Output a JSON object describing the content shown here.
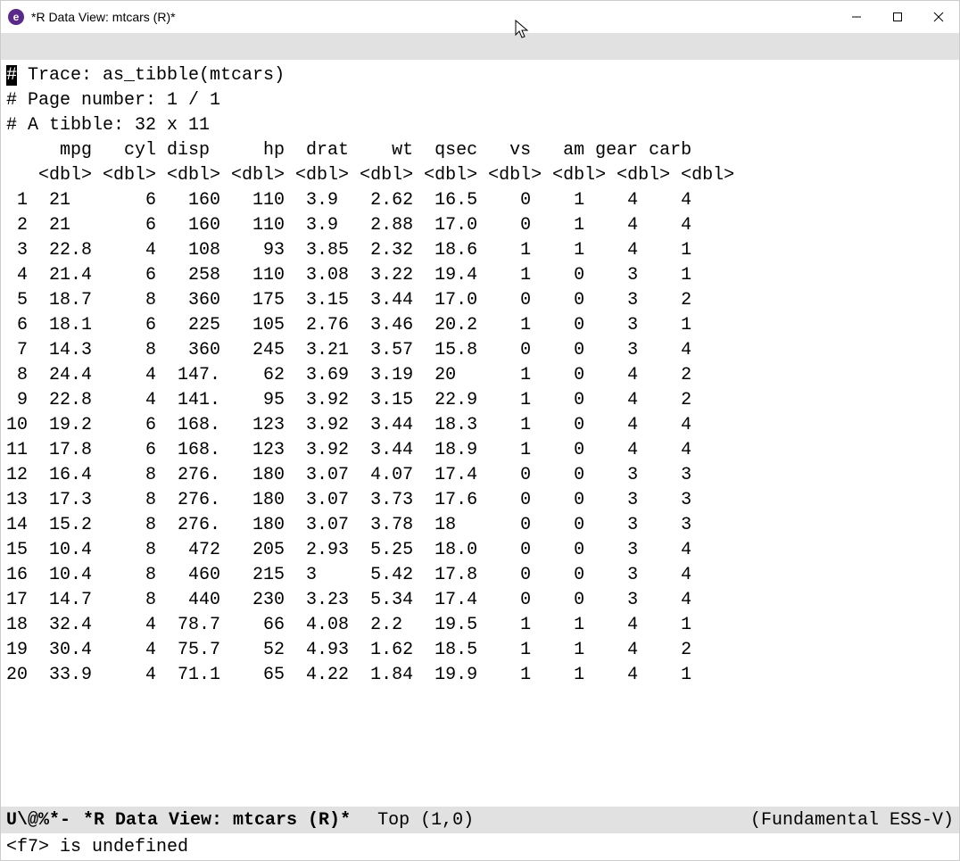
{
  "window": {
    "title": "*R Data View: mtcars (R)*"
  },
  "header": {
    "trace_prefix": "#",
    "trace_label": " Trace: as_tibble(mtcars)",
    "page_line": "# Page number: 1 / 1",
    "tibble_line": "# A tibble: 32 x 11"
  },
  "columns": [
    "mpg",
    "cyl",
    "disp",
    "hp",
    "drat",
    "wt",
    "qsec",
    "vs",
    "am",
    "gear",
    "carb"
  ],
  "types": [
    "<dbl>",
    "<dbl>",
    "<dbl>",
    "<dbl>",
    "<dbl>",
    "<dbl>",
    "<dbl>",
    "<dbl>",
    "<dbl>",
    "<dbl>",
    "<dbl>"
  ],
  "rows": [
    {
      "n": "1",
      "mpg": "21",
      "cyl": "6",
      "disp": "160",
      "hp": "110",
      "drat": "3.9",
      "wt": "2.62",
      "qsec": "16.5",
      "vs": "0",
      "am": "1",
      "gear": "4",
      "carb": "4"
    },
    {
      "n": "2",
      "mpg": "21",
      "cyl": "6",
      "disp": "160",
      "hp": "110",
      "drat": "3.9",
      "wt": "2.88",
      "qsec": "17.0",
      "vs": "0",
      "am": "1",
      "gear": "4",
      "carb": "4"
    },
    {
      "n": "3",
      "mpg": "22.8",
      "cyl": "4",
      "disp": "108",
      "hp": "93",
      "drat": "3.85",
      "wt": "2.32",
      "qsec": "18.6",
      "vs": "1",
      "am": "1",
      "gear": "4",
      "carb": "1"
    },
    {
      "n": "4",
      "mpg": "21.4",
      "cyl": "6",
      "disp": "258",
      "hp": "110",
      "drat": "3.08",
      "wt": "3.22",
      "qsec": "19.4",
      "vs": "1",
      "am": "0",
      "gear": "3",
      "carb": "1"
    },
    {
      "n": "5",
      "mpg": "18.7",
      "cyl": "8",
      "disp": "360",
      "hp": "175",
      "drat": "3.15",
      "wt": "3.44",
      "qsec": "17.0",
      "vs": "0",
      "am": "0",
      "gear": "3",
      "carb": "2"
    },
    {
      "n": "6",
      "mpg": "18.1",
      "cyl": "6",
      "disp": "225",
      "hp": "105",
      "drat": "2.76",
      "wt": "3.46",
      "qsec": "20.2",
      "vs": "1",
      "am": "0",
      "gear": "3",
      "carb": "1"
    },
    {
      "n": "7",
      "mpg": "14.3",
      "cyl": "8",
      "disp": "360",
      "hp": "245",
      "drat": "3.21",
      "wt": "3.57",
      "qsec": "15.8",
      "vs": "0",
      "am": "0",
      "gear": "3",
      "carb": "4"
    },
    {
      "n": "8",
      "mpg": "24.4",
      "cyl": "4",
      "disp": "147.",
      "hp": "62",
      "drat": "3.69",
      "wt": "3.19",
      "qsec": "20",
      "vs": "1",
      "am": "0",
      "gear": "4",
      "carb": "2"
    },
    {
      "n": "9",
      "mpg": "22.8",
      "cyl": "4",
      "disp": "141.",
      "hp": "95",
      "drat": "3.92",
      "wt": "3.15",
      "qsec": "22.9",
      "vs": "1",
      "am": "0",
      "gear": "4",
      "carb": "2"
    },
    {
      "n": "10",
      "mpg": "19.2",
      "cyl": "6",
      "disp": "168.",
      "hp": "123",
      "drat": "3.92",
      "wt": "3.44",
      "qsec": "18.3",
      "vs": "1",
      "am": "0",
      "gear": "4",
      "carb": "4"
    },
    {
      "n": "11",
      "mpg": "17.8",
      "cyl": "6",
      "disp": "168.",
      "hp": "123",
      "drat": "3.92",
      "wt": "3.44",
      "qsec": "18.9",
      "vs": "1",
      "am": "0",
      "gear": "4",
      "carb": "4"
    },
    {
      "n": "12",
      "mpg": "16.4",
      "cyl": "8",
      "disp": "276.",
      "hp": "180",
      "drat": "3.07",
      "wt": "4.07",
      "qsec": "17.4",
      "vs": "0",
      "am": "0",
      "gear": "3",
      "carb": "3"
    },
    {
      "n": "13",
      "mpg": "17.3",
      "cyl": "8",
      "disp": "276.",
      "hp": "180",
      "drat": "3.07",
      "wt": "3.73",
      "qsec": "17.6",
      "vs": "0",
      "am": "0",
      "gear": "3",
      "carb": "3"
    },
    {
      "n": "14",
      "mpg": "15.2",
      "cyl": "8",
      "disp": "276.",
      "hp": "180",
      "drat": "3.07",
      "wt": "3.78",
      "qsec": "18",
      "vs": "0",
      "am": "0",
      "gear": "3",
      "carb": "3"
    },
    {
      "n": "15",
      "mpg": "10.4",
      "cyl": "8",
      "disp": "472",
      "hp": "205",
      "drat": "2.93",
      "wt": "5.25",
      "qsec": "18.0",
      "vs": "0",
      "am": "0",
      "gear": "3",
      "carb": "4"
    },
    {
      "n": "16",
      "mpg": "10.4",
      "cyl": "8",
      "disp": "460",
      "hp": "215",
      "drat": "3",
      "wt": "5.42",
      "qsec": "17.8",
      "vs": "0",
      "am": "0",
      "gear": "3",
      "carb": "4"
    },
    {
      "n": "17",
      "mpg": "14.7",
      "cyl": "8",
      "disp": "440",
      "hp": "230",
      "drat": "3.23",
      "wt": "5.34",
      "qsec": "17.4",
      "vs": "0",
      "am": "0",
      "gear": "3",
      "carb": "4"
    },
    {
      "n": "18",
      "mpg": "32.4",
      "cyl": "4",
      "disp": "78.7",
      "hp": "66",
      "drat": "4.08",
      "wt": "2.2",
      "qsec": "19.5",
      "vs": "1",
      "am": "1",
      "gear": "4",
      "carb": "1"
    },
    {
      "n": "19",
      "mpg": "30.4",
      "cyl": "4",
      "disp": "75.7",
      "hp": "52",
      "drat": "4.93",
      "wt": "1.62",
      "qsec": "18.5",
      "vs": "1",
      "am": "1",
      "gear": "4",
      "carb": "2"
    },
    {
      "n": "20",
      "mpg": "33.9",
      "cyl": "4",
      "disp": "71.1",
      "hp": "65",
      "drat": "4.22",
      "wt": "1.84",
      "qsec": "19.9",
      "vs": "1",
      "am": "1",
      "gear": "4",
      "carb": "1"
    }
  ],
  "col_align": {
    "n": {
      "w": 2,
      "a": "r"
    },
    "mpg": {
      "w": 6,
      "a": "l",
      "pad": 2
    },
    "cyl": {
      "w": 5,
      "a": "r"
    },
    "disp": {
      "w": 6,
      "a": "r",
      "special": "disp"
    },
    "hp": {
      "w": 6,
      "a": "r"
    },
    "drat": {
      "w": 6,
      "a": "l",
      "pad": 2
    },
    "wt": {
      "w": 6,
      "a": "l",
      "pad": 2
    },
    "qsec": {
      "w": 6,
      "a": "l",
      "pad": 2
    },
    "vs": {
      "w": 5,
      "a": "r"
    },
    "am": {
      "w": 5,
      "a": "r"
    },
    "gear": {
      "w": 5,
      "a": "r"
    },
    "carb": {
      "w": 5,
      "a": "r"
    }
  },
  "modeline": {
    "left": "U\\@%*-",
    "buffer": "*R Data View: mtcars (R)*",
    "pos": "Top (1,0)",
    "mode": "(Fundamental ESS-V)"
  },
  "echo": "<f7> is undefined"
}
